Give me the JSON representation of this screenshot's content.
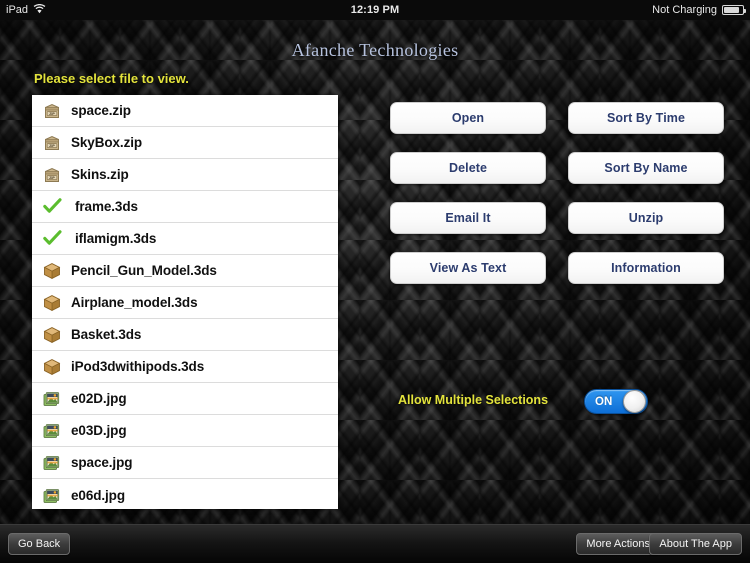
{
  "statusbar": {
    "device": "iPad",
    "wifi_icon": "wifi-icon",
    "time": "12:19 PM",
    "battery_text": "Not Charging",
    "battery_icon": "battery-icon"
  },
  "header": {
    "title": "Afanche Technologies",
    "prompt": "Please select file to view."
  },
  "file_list": {
    "items": [
      {
        "name": "space.zip",
        "icon": "zip-file-icon",
        "selected": false
      },
      {
        "name": "SkyBox.zip",
        "icon": "zip-file-icon",
        "selected": false
      },
      {
        "name": "Skins.zip",
        "icon": "zip-file-icon",
        "selected": false
      },
      {
        "name": "frame.3ds",
        "icon": "green-checkmark-icon",
        "selected": true
      },
      {
        "name": "iflamigm.3ds",
        "icon": "green-checkmark-icon",
        "selected": true
      },
      {
        "name": "Pencil_Gun_Model.3ds",
        "icon": "model-3d-box-icon",
        "selected": false
      },
      {
        "name": "Airplane_model.3ds",
        "icon": "model-3d-box-icon",
        "selected": false
      },
      {
        "name": "Basket.3ds",
        "icon": "model-3d-box-icon",
        "selected": false
      },
      {
        "name": "iPod3dwithipods.3ds",
        "icon": "model-3d-box-icon",
        "selected": false
      },
      {
        "name": "e02D.jpg",
        "icon": "image-file-icon",
        "selected": false
      },
      {
        "name": "e03D.jpg",
        "icon": "image-file-icon",
        "selected": false
      },
      {
        "name": "space.jpg",
        "icon": "image-file-icon",
        "selected": false
      },
      {
        "name": "e06d.jpg",
        "icon": "image-file-icon",
        "selected": false
      }
    ]
  },
  "actions": {
    "rows": [
      [
        {
          "label": "Open",
          "name": "open-button"
        },
        {
          "label": "Sort By Time",
          "name": "sort-by-time-button"
        }
      ],
      [
        {
          "label": "Delete",
          "name": "delete-button"
        },
        {
          "label": "Sort By Name",
          "name": "sort-by-name-button"
        }
      ],
      [
        {
          "label": "Email It",
          "name": "email-it-button"
        },
        {
          "label": "Unzip",
          "name": "unzip-button"
        }
      ],
      [
        {
          "label": "View As Text",
          "name": "view-as-text-button"
        },
        {
          "label": "Information",
          "name": "information-button"
        }
      ]
    ]
  },
  "multi_select": {
    "label": "Allow Multiple Selections",
    "state": "ON"
  },
  "toolbar": {
    "go_back": "Go Back",
    "more_actions": "More Actions",
    "about_the_app": "About The App"
  },
  "colors": {
    "title": "#b6c2de",
    "prompt_yellow": "#e3e33c",
    "button_text": "#2c3c6e",
    "toggle_on_blue": "#1a7ee8",
    "background": "#1c1c1c"
  }
}
